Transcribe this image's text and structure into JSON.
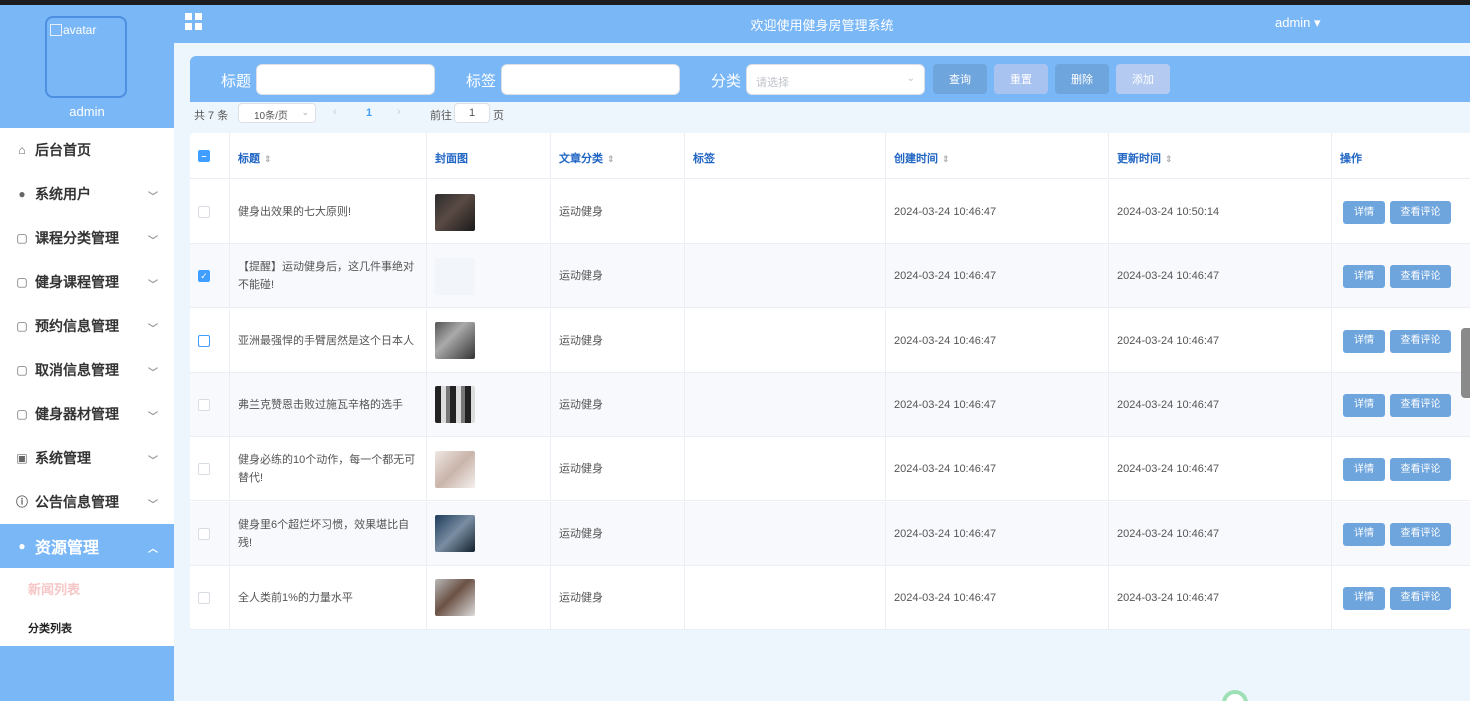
{
  "sidebar": {
    "avatar_alt": "avatar",
    "username": "admin",
    "items": [
      {
        "label": "后台首页",
        "icon": "home-icon",
        "glyph": "⌂",
        "chevron": false
      },
      {
        "label": "系统用户",
        "icon": "user-icon",
        "glyph": "●",
        "chevron": true
      },
      {
        "label": "课程分类管理",
        "icon": "folder-icon",
        "glyph": "▢",
        "chevron": true
      },
      {
        "label": "健身课程管理",
        "icon": "folder-icon",
        "glyph": "▢",
        "chevron": true
      },
      {
        "label": "预约信息管理",
        "icon": "folder-icon",
        "glyph": "▢",
        "chevron": true
      },
      {
        "label": "取消信息管理",
        "icon": "folder-icon",
        "glyph": "▢",
        "chevron": true
      },
      {
        "label": "健身器材管理",
        "icon": "folder-icon",
        "glyph": "▢",
        "chevron": true
      },
      {
        "label": "系统管理",
        "icon": "picture-icon",
        "glyph": "▣",
        "chevron": true
      },
      {
        "label": "公告信息管理",
        "icon": "info-icon",
        "glyph": "ⓘ",
        "chevron": true
      },
      {
        "label": "资源管理",
        "icon": "bulb-icon",
        "glyph": "●",
        "chevron": true,
        "active": true
      }
    ],
    "subitems": [
      {
        "label": "新闻列表",
        "current": true
      },
      {
        "label": "分类列表",
        "current": false
      }
    ]
  },
  "header": {
    "title": "欢迎使用健身房管理系统",
    "user": "admin ▾"
  },
  "search": {
    "title_label": "标题",
    "title_value": "",
    "tag_label": "标签",
    "tag_value": "",
    "category_label": "分类",
    "category_placeholder": "请选择",
    "buttons": [
      {
        "label": "查询",
        "color": "#6fa5dd"
      },
      {
        "label": "重置",
        "color": "#a9c3f0"
      },
      {
        "label": "删除",
        "color": "#6fa5dd"
      },
      {
        "label": "添加",
        "color": "#b5caf1"
      }
    ]
  },
  "pagination": {
    "total": "共 7 条",
    "page_size": "10条/页",
    "current": "1",
    "goto_label": "前往",
    "goto_value": "1",
    "goto_unit": "页"
  },
  "table": {
    "columns": [
      {
        "label": "标题",
        "sortable": true
      },
      {
        "label": "封面图",
        "sortable": false
      },
      {
        "label": "文章分类",
        "sortable": true
      },
      {
        "label": "标签",
        "sortable": false
      },
      {
        "label": "创建时间",
        "sortable": true
      },
      {
        "label": "更新时间",
        "sortable": true
      },
      {
        "label": "操作",
        "sortable": false
      }
    ],
    "header_checkbox": "indeterminate",
    "actions": {
      "detail": "详情",
      "comments": "查看评论"
    },
    "rows": [
      {
        "title": "健身出效果的七大原则!",
        "category": "运动健身",
        "tag": "",
        "created": "2024-03-24 10:46:47",
        "updated": "2024-03-24 10:50:14",
        "checked": false,
        "cover": "dark"
      },
      {
        "title": "【提醒】运动健身后，这几件事绝对不能碰!",
        "category": "运动健身",
        "tag": "",
        "created": "2024-03-24 10:46:47",
        "updated": "2024-03-24 10:46:47",
        "checked": true,
        "cover": "blank"
      },
      {
        "title": "亚洲最强悍的手臂居然是这个日本人",
        "category": "运动健身",
        "tag": "",
        "created": "2024-03-24 10:46:47",
        "updated": "2024-03-24 10:46:47",
        "checked": false,
        "cover": "gray"
      },
      {
        "title": "弗兰克赞恩击败过施瓦辛格的选手",
        "category": "运动健身",
        "tag": "",
        "created": "2024-03-24 10:46:47",
        "updated": "2024-03-24 10:46:47",
        "checked": false,
        "cover": "bw"
      },
      {
        "title": "健身必练的10个动作，每一个都无可替代!",
        "category": "运动健身",
        "tag": "",
        "created": "2024-03-24 10:46:47",
        "updated": "2024-03-24 10:46:47",
        "checked": false,
        "cover": "light"
      },
      {
        "title": "健身里6个超烂坏习惯，效果堪比自残!",
        "category": "运动健身",
        "tag": "",
        "created": "2024-03-24 10:46:47",
        "updated": "2024-03-24 10:46:47",
        "checked": false,
        "cover": "blue"
      },
      {
        "title": "全人类前1%的力量水平",
        "category": "运动健身",
        "tag": "",
        "created": "2024-03-24 10:46:47",
        "updated": "2024-03-24 10:46:47",
        "checked": false,
        "cover": "gym"
      }
    ]
  }
}
